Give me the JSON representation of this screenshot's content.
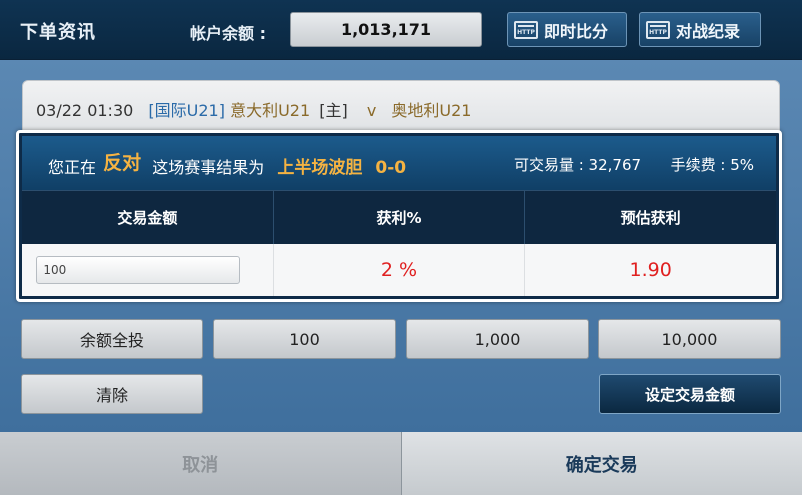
{
  "header": {
    "title": "下单资讯",
    "balance_label": "帐户余额 :",
    "balance_value": "1,013,171",
    "live_score_label": "即时比分",
    "match_record_label": "对战纪录",
    "http_icon_text": "HTTP"
  },
  "event": {
    "datetime": "03/22 01:30",
    "league": "[国际U21]",
    "home_team": "意大利U21",
    "home_tag": "[主]",
    "vs": "v",
    "away_team": "奥地利U21"
  },
  "bet": {
    "prefix": "您正在",
    "side": "反对",
    "middle": "这场赛事结果为",
    "market": "上半场波胆",
    "score": "0-0",
    "tradable_label": "可交易量 : 32,767",
    "fee_label": "手续费 : 5%"
  },
  "table": {
    "headers": [
      "交易金额",
      "获利%",
      "预估获利"
    ],
    "amount_value": "100",
    "profit_pct": "2 %",
    "est_profit": "1.90"
  },
  "quick_amounts": {
    "all_in": "余额全投",
    "a100": "100",
    "a1000": "1,000",
    "a10000": "10,000",
    "clear": "清除",
    "set_amount": "设定交易金额"
  },
  "footer": {
    "cancel": "取消",
    "confirm": "确定交易"
  }
}
